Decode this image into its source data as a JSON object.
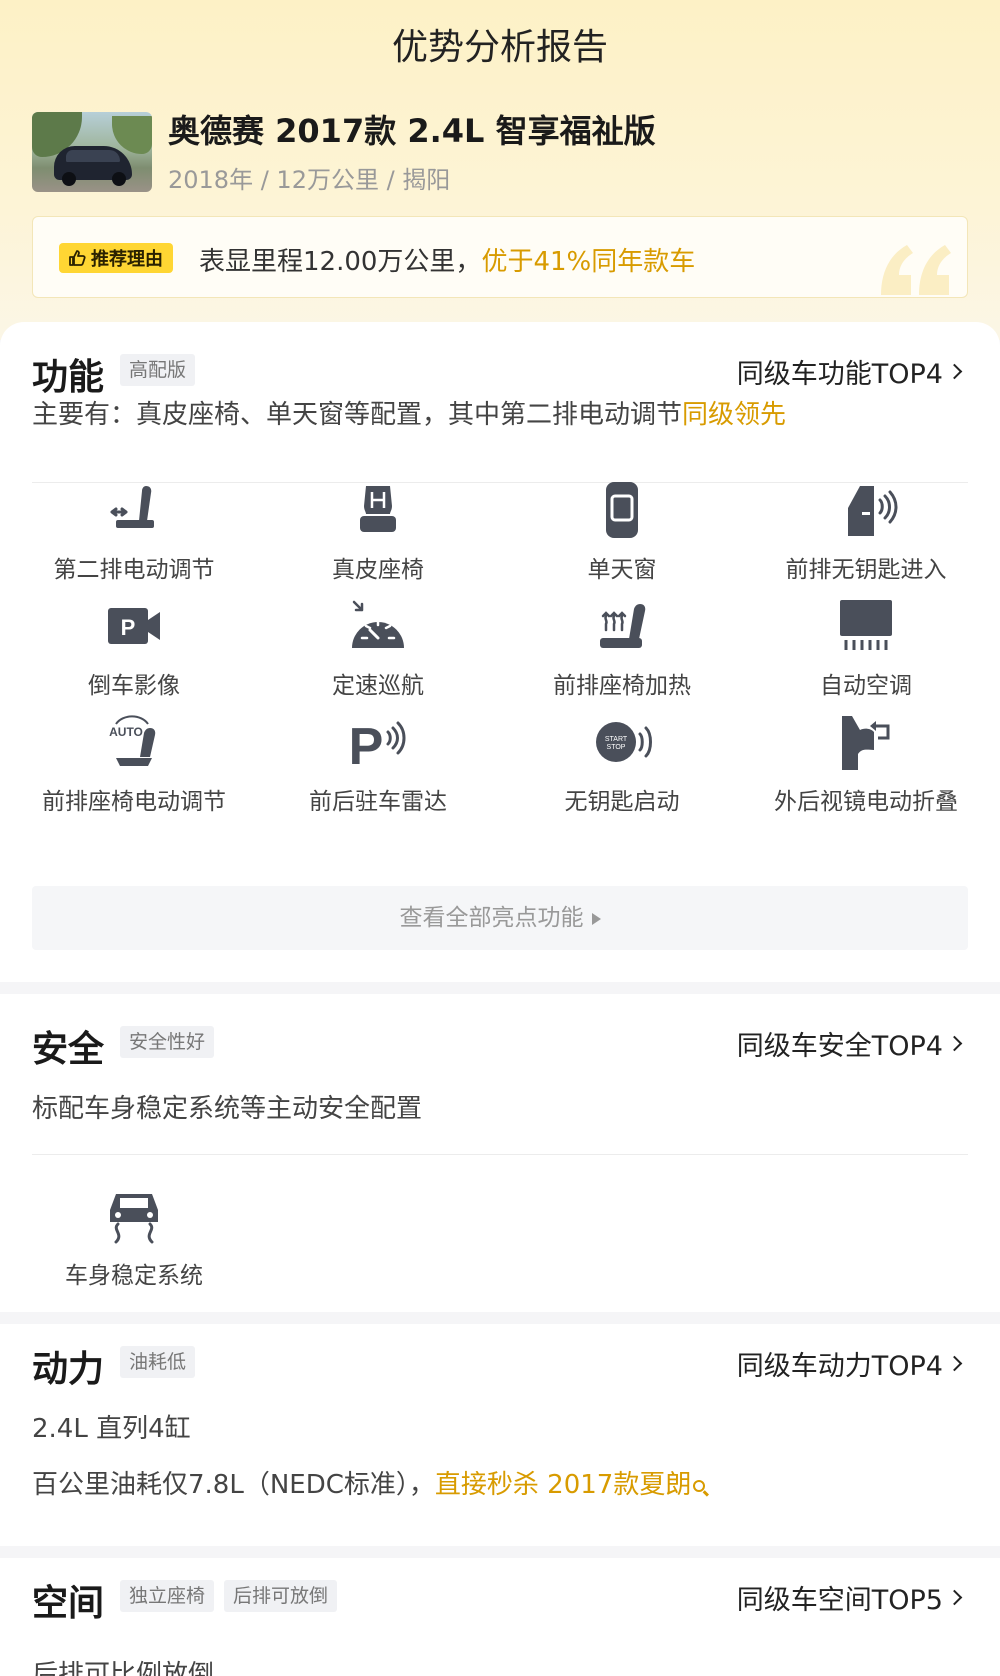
{
  "header": {
    "title": "优势分析报告",
    "car_name": "奥德赛 2017款 2.4L 智享福祉版",
    "car_meta": "2018年 / 12万公里 / 揭阳",
    "reason_tag": "推荐理由",
    "reason_text": "表显里程12.00万公里，",
    "reason_highlight": "优于41%同年款车"
  },
  "function": {
    "title": "功能",
    "tag": "高配版",
    "top_link": "同级车功能TOP4",
    "desc": "主要有：真皮座椅、单天窗等配置，其中第二排电动调节",
    "desc_highlight": "同级领先",
    "features": [
      {
        "label": "第二排电动调节",
        "icon": "second-row-seat-adjust-icon"
      },
      {
        "label": "真皮座椅",
        "icon": "leather-seat-icon"
      },
      {
        "label": "单天窗",
        "icon": "sunroof-icon"
      },
      {
        "label": "前排无钥匙进入",
        "icon": "keyless-entry-icon"
      },
      {
        "label": "倒车影像",
        "icon": "reverse-camera-icon"
      },
      {
        "label": "定速巡航",
        "icon": "cruise-control-icon"
      },
      {
        "label": "前排座椅加热",
        "icon": "seat-heating-icon"
      },
      {
        "label": "自动空调",
        "icon": "auto-ac-icon"
      },
      {
        "label": "前排座椅电动调节",
        "icon": "power-seat-icon"
      },
      {
        "label": "前后驻车雷达",
        "icon": "parking-radar-icon"
      },
      {
        "label": "无钥匙启动",
        "icon": "keyless-start-icon"
      },
      {
        "label": "外后视镜电动折叠",
        "icon": "mirror-fold-icon"
      }
    ],
    "view_all": "查看全部亮点功能"
  },
  "safety": {
    "title": "安全",
    "tag": "安全性好",
    "top_link": "同级车安全TOP4",
    "desc": "标配车身稳定系统等主动安全配置",
    "features": [
      {
        "label": "车身稳定系统",
        "icon": "stability-control-icon"
      }
    ]
  },
  "power": {
    "title": "动力",
    "tag": "油耗低",
    "top_link": "同级车动力TOP4",
    "line1": "2.4L 直列4缸",
    "line2": "百公里油耗仅7.8L（NEDC标准），",
    "line2_highlight": "直接秒杀 2017款夏朗"
  },
  "space": {
    "title": "空间",
    "tags": [
      "独立座椅",
      "后排可放倒"
    ],
    "top_link": "同级车空间TOP5",
    "desc": "后排可比例放倒"
  },
  "colors": {
    "accent": "#d89b00",
    "tag_yellow": "#ffd633",
    "icon_gray": "#4a4f5a"
  }
}
